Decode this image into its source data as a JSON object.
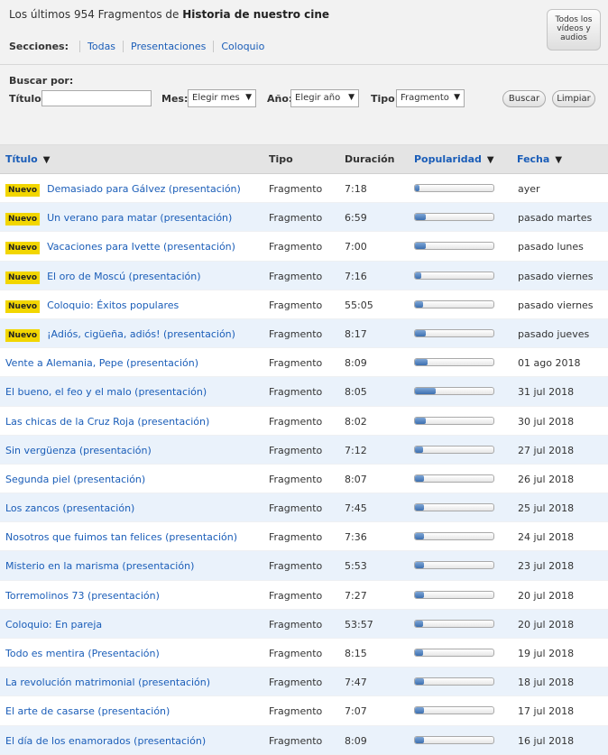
{
  "header": {
    "title_prefix": "Los últimos 954 Fragmentos de ",
    "title_strong": "Historia de nuestro cine",
    "all_button": "Todos los vídeos y audios",
    "sections_label": "Secciones:",
    "sections": [
      "Todas",
      "Presentaciones",
      "Coloquio"
    ]
  },
  "search": {
    "label": "Buscar por:",
    "titulo_label": "Título:",
    "titulo_value": "",
    "mes_label": "Mes:",
    "mes_value": "Elegir mes",
    "anio_label": "Año:",
    "anio_value": "Elegir año",
    "tipo_label": "Tipo:",
    "tipo_value": "Fragmento",
    "buscar_button": "Buscar",
    "limpiar_button": "Limpiar"
  },
  "table": {
    "headers": {
      "titulo": "Título",
      "tipo": "Tipo",
      "duracion": "Duración",
      "popularidad": "Popularidad",
      "fecha": "Fecha"
    },
    "badge_new": "Nuevo",
    "colors": {
      "link": "#1a5db8",
      "badge": "#f2d600",
      "row_alt": "#eaf2fb"
    },
    "rows": [
      {
        "nuevo": true,
        "titulo": "Demasiado para Gálvez (presentación)",
        "tipo": "Fragmento",
        "duracion": "7:18",
        "popularidad": 0.06,
        "fecha": "ayer"
      },
      {
        "nuevo": true,
        "titulo": "Un verano para matar (presentación)",
        "tipo": "Fragmento",
        "duracion": "6:59",
        "popularidad": 0.14,
        "fecha": "pasado martes"
      },
      {
        "nuevo": true,
        "titulo": "Vacaciones para Ivette (presentación)",
        "tipo": "Fragmento",
        "duracion": "7:00",
        "popularidad": 0.14,
        "fecha": "pasado lunes"
      },
      {
        "nuevo": true,
        "titulo": "El oro de Moscú (presentación)",
        "tipo": "Fragmento",
        "duracion": "7:16",
        "popularidad": 0.08,
        "fecha": "pasado viernes"
      },
      {
        "nuevo": true,
        "titulo": "Coloquio: Éxitos populares",
        "tipo": "Fragmento",
        "duracion": "55:05",
        "popularidad": 0.1,
        "fecha": "pasado viernes"
      },
      {
        "nuevo": true,
        "titulo": "¡Adiós, cigüeña, adiós! (presentación)",
        "tipo": "Fragmento",
        "duracion": "8:17",
        "popularidad": 0.14,
        "fecha": "pasado jueves"
      },
      {
        "nuevo": false,
        "titulo": "Vente a Alemania, Pepe (presentación)",
        "tipo": "Fragmento",
        "duracion": "8:09",
        "popularidad": 0.16,
        "fecha": "01 ago 2018"
      },
      {
        "nuevo": false,
        "titulo": "El bueno, el feo y el malo (presentación)",
        "tipo": "Fragmento",
        "duracion": "8:05",
        "popularidad": 0.26,
        "fecha": "31 jul 2018"
      },
      {
        "nuevo": false,
        "titulo": "Las chicas de la Cruz Roja (presentación)",
        "tipo": "Fragmento",
        "duracion": "8:02",
        "popularidad": 0.14,
        "fecha": "30 jul 2018"
      },
      {
        "nuevo": false,
        "titulo": "Sin vergüenza (presentación)",
        "tipo": "Fragmento",
        "duracion": "7:12",
        "popularidad": 0.1,
        "fecha": "27 jul 2018"
      },
      {
        "nuevo": false,
        "titulo": "Segunda piel (presentación)",
        "tipo": "Fragmento",
        "duracion": "8:07",
        "popularidad": 0.12,
        "fecha": "26 jul 2018"
      },
      {
        "nuevo": false,
        "titulo": "Los zancos (presentación)",
        "tipo": "Fragmento",
        "duracion": "7:45",
        "popularidad": 0.12,
        "fecha": "25 jul 2018"
      },
      {
        "nuevo": false,
        "titulo": "Nosotros que fuimos tan felices (presentación)",
        "tipo": "Fragmento",
        "duracion": "7:36",
        "popularidad": 0.12,
        "fecha": "24 jul 2018"
      },
      {
        "nuevo": false,
        "titulo": "Misterio en la marisma (presentación)",
        "tipo": "Fragmento",
        "duracion": "5:53",
        "popularidad": 0.12,
        "fecha": "23 jul 2018"
      },
      {
        "nuevo": false,
        "titulo": "Torremolinos 73 (presentación)",
        "tipo": "Fragmento",
        "duracion": "7:27",
        "popularidad": 0.12,
        "fecha": "20 jul 2018"
      },
      {
        "nuevo": false,
        "titulo": "Coloquio: En pareja",
        "tipo": "Fragmento",
        "duracion": "53:57",
        "popularidad": 0.1,
        "fecha": "20 jul 2018"
      },
      {
        "nuevo": false,
        "titulo": "Todo es mentira (Presentación)",
        "tipo": "Fragmento",
        "duracion": "8:15",
        "popularidad": 0.1,
        "fecha": "19 jul 2018"
      },
      {
        "nuevo": false,
        "titulo": "La revolución matrimonial (presentación)",
        "tipo": "Fragmento",
        "duracion": "7:47",
        "popularidad": 0.12,
        "fecha": "18 jul 2018"
      },
      {
        "nuevo": false,
        "titulo": "El arte de casarse (presentación)",
        "tipo": "Fragmento",
        "duracion": "7:07",
        "popularidad": 0.12,
        "fecha": "17 jul 2018"
      },
      {
        "nuevo": false,
        "titulo": "El día de los enamorados (presentación)",
        "tipo": "Fragmento",
        "duracion": "8:09",
        "popularidad": 0.12,
        "fecha": "16 jul 2018"
      }
    ]
  }
}
